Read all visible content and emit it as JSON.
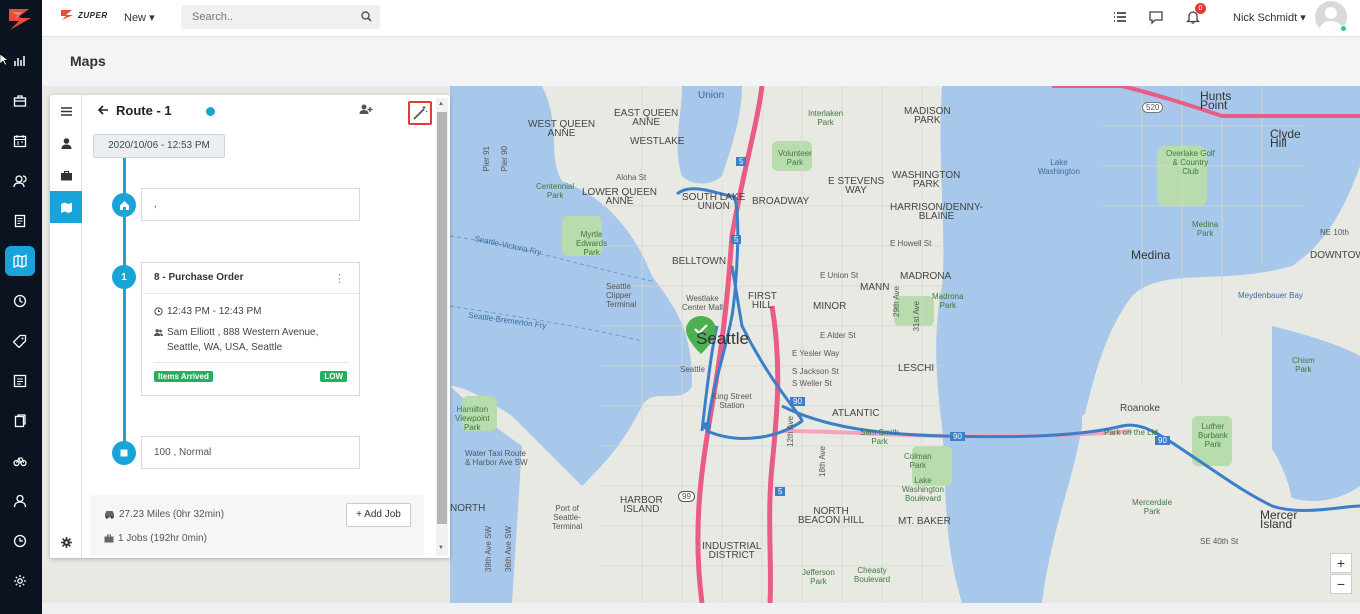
{
  "app": {
    "brand": "ZUPER",
    "new_menu": "New",
    "search_placeholder": "Search..",
    "user_name": "Nick Schmidt",
    "notification_count": "0",
    "page_title": "Maps"
  },
  "nav": {
    "items": [
      "logo",
      "analytics",
      "dispatch",
      "calendar",
      "customers",
      "invoices",
      "maps",
      "timesheet",
      "tags",
      "reports",
      "contracts",
      "assets",
      "users",
      "support",
      "settings"
    ]
  },
  "route": {
    "title": "Route - 1",
    "date": "2020/10/06 - 12:53 PM",
    "start_stop": ",",
    "job": {
      "number": "1",
      "title": "8 - Purchase Order",
      "time": "12:43 PM - 12:43 PM",
      "address_line1": "Sam Elliott , 888 Western Avenue,",
      "address_line2": "Seattle, WA, USA, Seattle",
      "status": "Items Arrived",
      "priority": "LOW"
    },
    "end_stop": "100 , Normal",
    "distance": "27.23 Miles (0hr 32min)",
    "jobs": "1 Jobs (192hr 0min)",
    "add_job": "+ Add Job"
  },
  "map": {
    "labels": {
      "seattle": "Seattle",
      "medina": "Medina",
      "mercer_island": "Mercer\nIsland",
      "hunts_point": "Hunts\nPoint",
      "clyde_hill": "Clyde\nHill",
      "union": "Union",
      "west_queen_anne": "WEST QUEEN\nANNE",
      "east_queen": "EAST QUEEN\nANNE",
      "interlaken": "Interlaken\nPark",
      "madison_park": "MADISON\nPARK",
      "westlake": "WESTLAKE",
      "volunteer_park": "Volunteer\nPark",
      "washington_park": "WASHINGTON\nPARK",
      "aloha": "Aloha St",
      "south_lake": "SOUTH LAKE\nUNION",
      "broadway": "BROADWAY",
      "e_stevens": "E STEVENS\nWAY",
      "harrison": "HARRISON/DENNY-\nBLAINE",
      "lower_queen": "LOWER QUEEN\nANNE",
      "lake_washington": "Lake\nWashington",
      "myrtle": "Myrtle\nEdwards\nPark",
      "belltown": "BELLTOWN",
      "e_howell": "E Howell St",
      "e_union": "E Union St",
      "madrona": "MADRONA",
      "first_hill": "FIRST\nHILL",
      "minor": "MINOR",
      "mann": "MANN",
      "madrona_park": "Madrona\nPark",
      "e_alder": "E Alder St",
      "e_yesler": "E Yesler Way",
      "s_jackson": "S Jackson St",
      "s_weller": "S Weller St",
      "leschi": "LESCHI",
      "atlantic": "ATLANTIC",
      "king_street": "King Street\nStation",
      "seattle_ferry": "Seattle-Victoria Fry",
      "bremerton_ferry": "Seattle-Bremerton Fry",
      "hamilton": "Hamilton\nViewpoint\nPark",
      "water_taxi": "Water Taxi Route\n& Harbor Ave SW",
      "harbor_island": "HARBOR\nISLAND",
      "port_of_seattle": "Port of\nSeattle-\nTerminal",
      "colman": "Colman\nPark",
      "lake_washington_blvd": "Lake\nWashington\nBoulevard",
      "north_beacon": "NORTH\nBEACON HILL",
      "mt_baker": "MT. BAKER",
      "industrial": "INDUSTRIAL\nDISTRICT",
      "jefferson": "Jefferson\nPark",
      "cheasty": "Cheasty\nBoulevard",
      "sam_smith": "Sam Smith\nPark",
      "roanoke": "Roanoke",
      "park_on_lid": "Park on the Lid",
      "luther": "Luther\nBurbank\nPark",
      "mercerdale": "Mercerdale\nPark",
      "se_40th": "SE 40th St",
      "overlake": "Overlake Golf\n& Country\nClub",
      "medina_park": "Medina\nPark",
      "meydenbauer": "Meydenbauer Bay",
      "chism": "Chism\nPark",
      "downtown": "DOWNTOWN",
      "ne_10th": "NE 10th",
      "clipper": "Seattle\nClipper\nTerminal",
      "westlake_center": "Westlake\nCenter Mall",
      "seattle_small": "Seattle",
      "centennial": "Centennial\nPark",
      "pier91": "Pier 91",
      "pier90": "Pier 90",
      "north_label": "NORTH",
      "sw_39": "39th Ave SW",
      "sw_36": "36th Ave SW",
      "i520": "520",
      "i5a": "5",
      "i5b": "5",
      "i5c": "5",
      "i90a": "90",
      "i90b": "90",
      "i90c": "90",
      "r99": "99",
      "ave12": "12th Ave",
      "ave18": "18th Ave",
      "ave29": "29th Ave",
      "ave31": "31st Ave"
    }
  },
  "colors": {
    "accent": "#1aa3d9",
    "status_green": "#27ae60",
    "highlight_red": "#e53935",
    "route_blue": "#3a7fc8"
  }
}
